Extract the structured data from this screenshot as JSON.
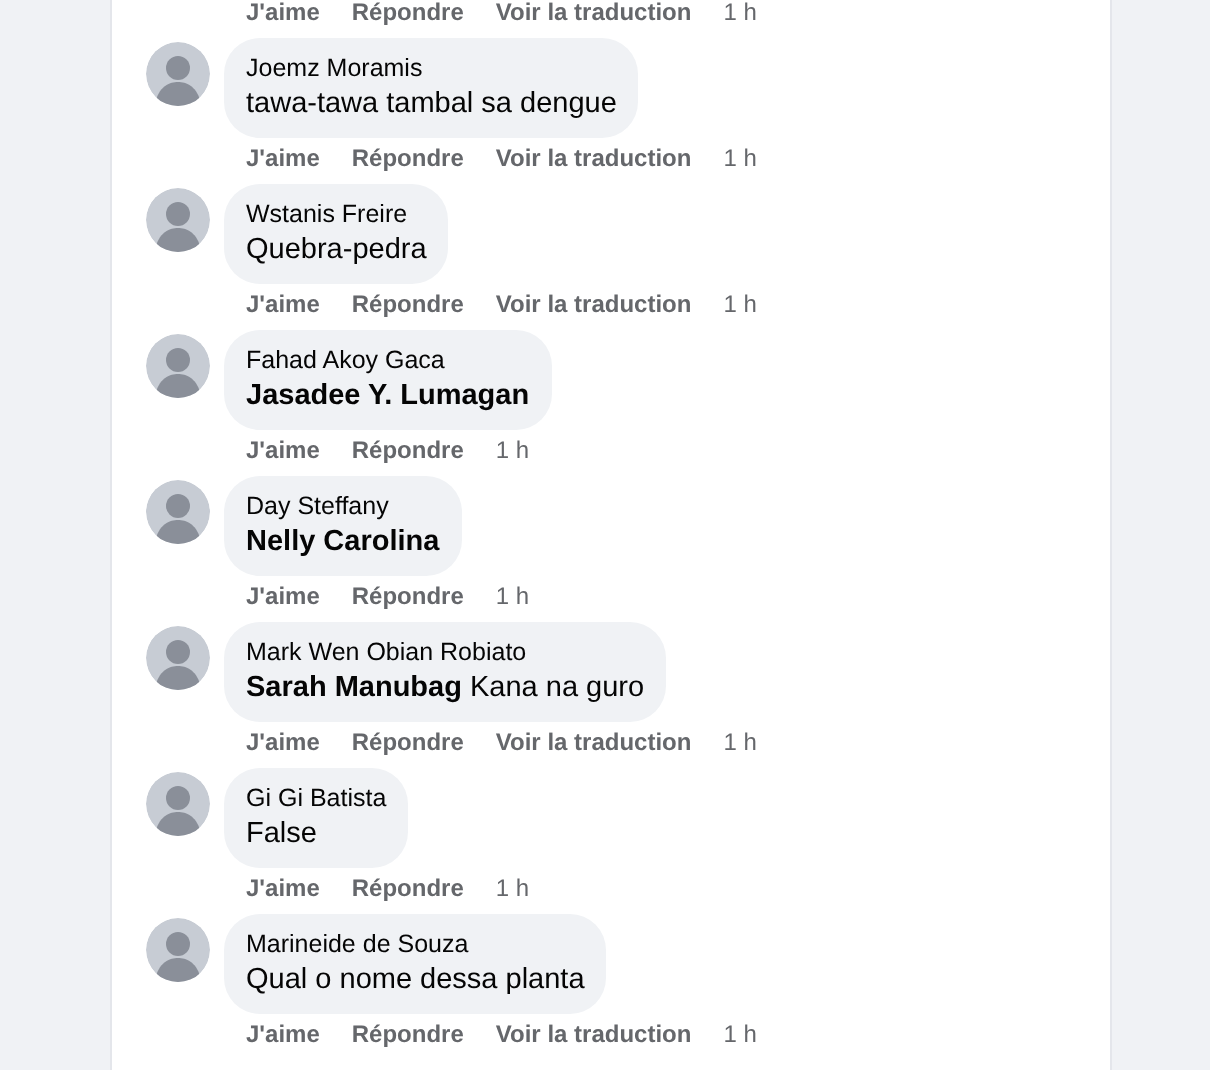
{
  "top_actions": {
    "actions": [
      "J'aime",
      "Répondre",
      "Voir la traduction"
    ],
    "time": "1 h"
  },
  "comments": [
    {
      "author": "Joemz Moramis",
      "text": "tawa-tawa tambal sa dengue",
      "actions": [
        "J'aime",
        "Répondre",
        "Voir la traduction"
      ],
      "time": "1 h"
    },
    {
      "author": "Wstanis Freire",
      "text": "Quebra-pedra",
      "actions": [
        "J'aime",
        "Répondre",
        "Voir la traduction"
      ],
      "time": "1 h"
    },
    {
      "author": "Fahad Akoy Gaca",
      "tag": "Jasadee Y. Lumagan",
      "actions": [
        "J'aime",
        "Répondre"
      ],
      "time": "1 h"
    },
    {
      "author": "Day Steffany",
      "tag": "Nelly Carolina",
      "actions": [
        "J'aime",
        "Répondre"
      ],
      "time": "1 h"
    },
    {
      "author": "Mark Wen Obian Robiato",
      "tag": "Sarah Manubag",
      "text": "Kana na guro",
      "actions": [
        "J'aime",
        "Répondre",
        "Voir la traduction"
      ],
      "time": "1 h"
    },
    {
      "author": "Gi Gi Batista",
      "text": "False",
      "actions": [
        "J'aime",
        "Répondre"
      ],
      "time": "1 h"
    },
    {
      "author": "Marineide de Souza",
      "text": "Qual o nome dessa planta",
      "actions": [
        "J'aime",
        "Répondre",
        "Voir la traduction"
      ],
      "time": "1 h"
    }
  ]
}
